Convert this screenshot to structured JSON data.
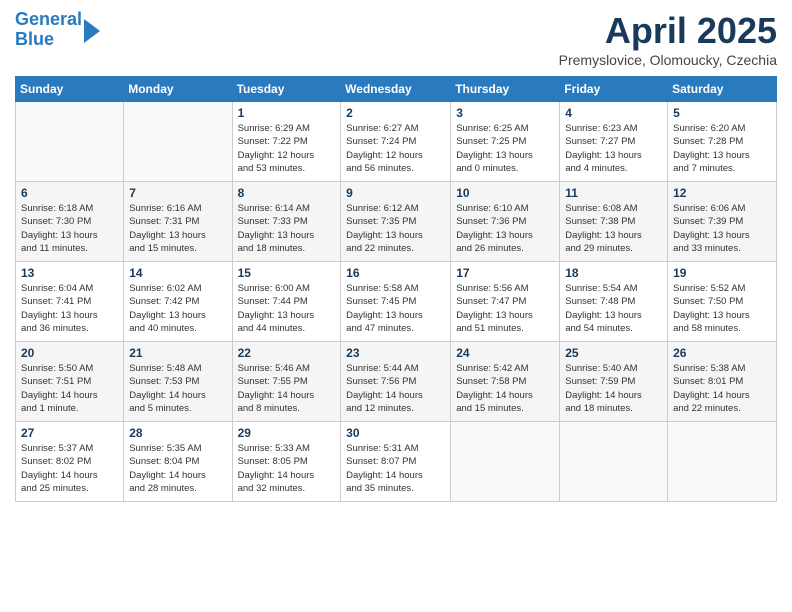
{
  "header": {
    "logo_line1": "General",
    "logo_line2": "Blue",
    "month": "April 2025",
    "location": "Premyslovice, Olomoucky, Czechia"
  },
  "weekdays": [
    "Sunday",
    "Monday",
    "Tuesday",
    "Wednesday",
    "Thursday",
    "Friday",
    "Saturday"
  ],
  "weeks": [
    [
      {
        "day": "",
        "info": ""
      },
      {
        "day": "",
        "info": ""
      },
      {
        "day": "1",
        "info": "Sunrise: 6:29 AM\nSunset: 7:22 PM\nDaylight: 12 hours\nand 53 minutes."
      },
      {
        "day": "2",
        "info": "Sunrise: 6:27 AM\nSunset: 7:24 PM\nDaylight: 12 hours\nand 56 minutes."
      },
      {
        "day": "3",
        "info": "Sunrise: 6:25 AM\nSunset: 7:25 PM\nDaylight: 13 hours\nand 0 minutes."
      },
      {
        "day": "4",
        "info": "Sunrise: 6:23 AM\nSunset: 7:27 PM\nDaylight: 13 hours\nand 4 minutes."
      },
      {
        "day": "5",
        "info": "Sunrise: 6:20 AM\nSunset: 7:28 PM\nDaylight: 13 hours\nand 7 minutes."
      }
    ],
    [
      {
        "day": "6",
        "info": "Sunrise: 6:18 AM\nSunset: 7:30 PM\nDaylight: 13 hours\nand 11 minutes."
      },
      {
        "day": "7",
        "info": "Sunrise: 6:16 AM\nSunset: 7:31 PM\nDaylight: 13 hours\nand 15 minutes."
      },
      {
        "day": "8",
        "info": "Sunrise: 6:14 AM\nSunset: 7:33 PM\nDaylight: 13 hours\nand 18 minutes."
      },
      {
        "day": "9",
        "info": "Sunrise: 6:12 AM\nSunset: 7:35 PM\nDaylight: 13 hours\nand 22 minutes."
      },
      {
        "day": "10",
        "info": "Sunrise: 6:10 AM\nSunset: 7:36 PM\nDaylight: 13 hours\nand 26 minutes."
      },
      {
        "day": "11",
        "info": "Sunrise: 6:08 AM\nSunset: 7:38 PM\nDaylight: 13 hours\nand 29 minutes."
      },
      {
        "day": "12",
        "info": "Sunrise: 6:06 AM\nSunset: 7:39 PM\nDaylight: 13 hours\nand 33 minutes."
      }
    ],
    [
      {
        "day": "13",
        "info": "Sunrise: 6:04 AM\nSunset: 7:41 PM\nDaylight: 13 hours\nand 36 minutes."
      },
      {
        "day": "14",
        "info": "Sunrise: 6:02 AM\nSunset: 7:42 PM\nDaylight: 13 hours\nand 40 minutes."
      },
      {
        "day": "15",
        "info": "Sunrise: 6:00 AM\nSunset: 7:44 PM\nDaylight: 13 hours\nand 44 minutes."
      },
      {
        "day": "16",
        "info": "Sunrise: 5:58 AM\nSunset: 7:45 PM\nDaylight: 13 hours\nand 47 minutes."
      },
      {
        "day": "17",
        "info": "Sunrise: 5:56 AM\nSunset: 7:47 PM\nDaylight: 13 hours\nand 51 minutes."
      },
      {
        "day": "18",
        "info": "Sunrise: 5:54 AM\nSunset: 7:48 PM\nDaylight: 13 hours\nand 54 minutes."
      },
      {
        "day": "19",
        "info": "Sunrise: 5:52 AM\nSunset: 7:50 PM\nDaylight: 13 hours\nand 58 minutes."
      }
    ],
    [
      {
        "day": "20",
        "info": "Sunrise: 5:50 AM\nSunset: 7:51 PM\nDaylight: 14 hours\nand 1 minute."
      },
      {
        "day": "21",
        "info": "Sunrise: 5:48 AM\nSunset: 7:53 PM\nDaylight: 14 hours\nand 5 minutes."
      },
      {
        "day": "22",
        "info": "Sunrise: 5:46 AM\nSunset: 7:55 PM\nDaylight: 14 hours\nand 8 minutes."
      },
      {
        "day": "23",
        "info": "Sunrise: 5:44 AM\nSunset: 7:56 PM\nDaylight: 14 hours\nand 12 minutes."
      },
      {
        "day": "24",
        "info": "Sunrise: 5:42 AM\nSunset: 7:58 PM\nDaylight: 14 hours\nand 15 minutes."
      },
      {
        "day": "25",
        "info": "Sunrise: 5:40 AM\nSunset: 7:59 PM\nDaylight: 14 hours\nand 18 minutes."
      },
      {
        "day": "26",
        "info": "Sunrise: 5:38 AM\nSunset: 8:01 PM\nDaylight: 14 hours\nand 22 minutes."
      }
    ],
    [
      {
        "day": "27",
        "info": "Sunrise: 5:37 AM\nSunset: 8:02 PM\nDaylight: 14 hours\nand 25 minutes."
      },
      {
        "day": "28",
        "info": "Sunrise: 5:35 AM\nSunset: 8:04 PM\nDaylight: 14 hours\nand 28 minutes."
      },
      {
        "day": "29",
        "info": "Sunrise: 5:33 AM\nSunset: 8:05 PM\nDaylight: 14 hours\nand 32 minutes."
      },
      {
        "day": "30",
        "info": "Sunrise: 5:31 AM\nSunset: 8:07 PM\nDaylight: 14 hours\nand 35 minutes."
      },
      {
        "day": "",
        "info": ""
      },
      {
        "day": "",
        "info": ""
      },
      {
        "day": "",
        "info": ""
      }
    ]
  ]
}
